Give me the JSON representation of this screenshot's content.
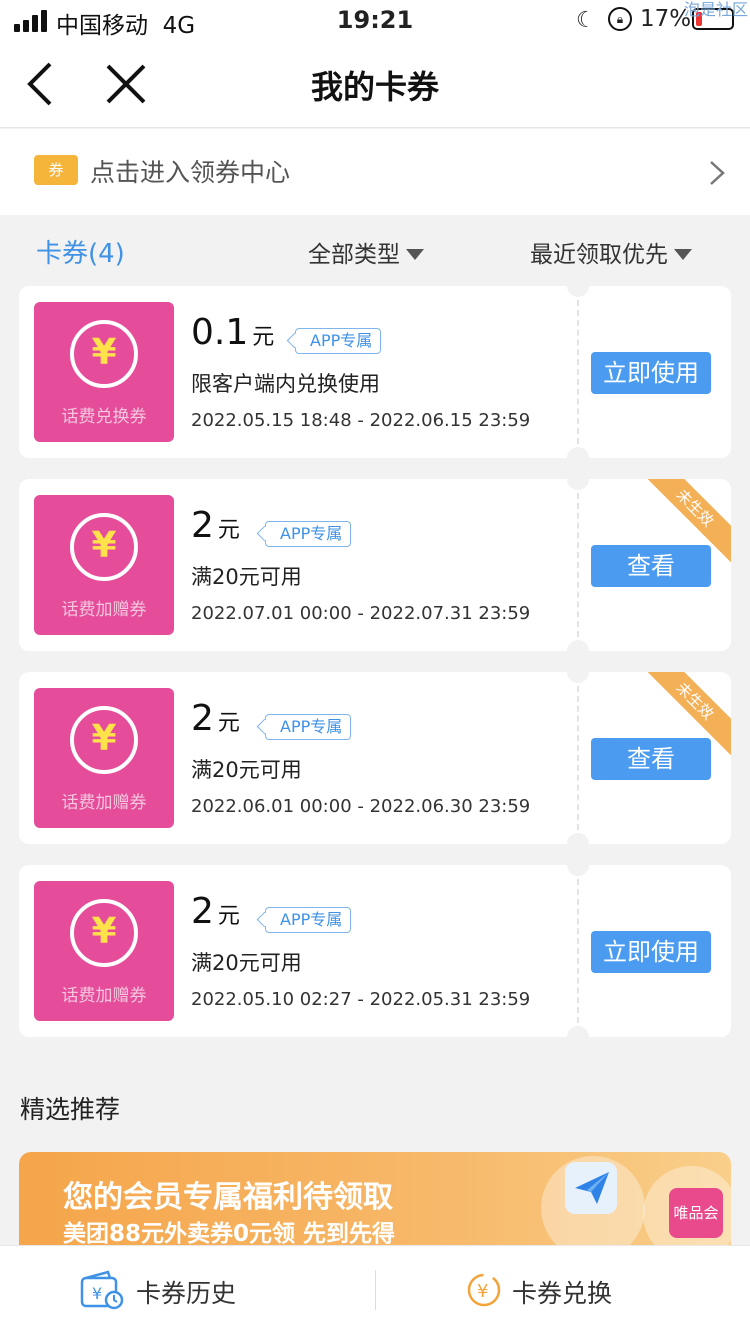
{
  "status_bar": {
    "carrier": "中国移动",
    "network": "4G",
    "time": "19:21",
    "battery": "17%",
    "watermark": "泡是社区"
  },
  "nav": {
    "title": "我的卡券",
    "back_icon": "chevron-left-icon",
    "close_icon": "close-icon"
  },
  "coupon_center": {
    "tag": "券",
    "text": "点击进入领券中心"
  },
  "filter": {
    "count_label": "卡券(4)",
    "type_label": "全部类型",
    "sort_label": "最近领取优先"
  },
  "coupons": [
    {
      "thumb_label": "话费兑换券",
      "amount": "0.1",
      "unit": "元",
      "app_tag": "APP专属",
      "desc": "限客户端内兑换使用",
      "date": "2022.05.15 18:48 - 2022.06.15 23:59",
      "button": "立即使用",
      "ribbon": ""
    },
    {
      "thumb_label": "话费加赠券",
      "amount": "2",
      "unit": "元",
      "app_tag": "APP专属",
      "desc": "满20元可用",
      "date": "2022.07.01 00:00 - 2022.07.31 23:59",
      "button": "查看",
      "ribbon": "未生效"
    },
    {
      "thumb_label": "话费加赠券",
      "amount": "2",
      "unit": "元",
      "app_tag": "APP专属",
      "desc": "满20元可用",
      "date": "2022.06.01 00:00 - 2022.06.30 23:59",
      "button": "查看",
      "ribbon": "未生效"
    },
    {
      "thumb_label": "话费加赠券",
      "amount": "2",
      "unit": "元",
      "app_tag": "APP专属",
      "desc": "满20元可用",
      "date": "2022.05.10 02:27 - 2022.05.31 23:59",
      "button": "立即使用",
      "ribbon": ""
    }
  ],
  "recommend": {
    "title": "精选推荐",
    "banner_line1": "您的会员专属福利待领取",
    "banner_line2": "美团88元外卖券0元领 先到先得",
    "banner_badge": "唯品会"
  },
  "bottom_bar": {
    "history_label": "卡券历史",
    "exchange_label": "卡券兑换"
  },
  "colors": {
    "accent_blue": "#4b9cf0",
    "coupon_pink": "#e54d9b",
    "ribbon_orange": "#f3a33a",
    "yen_yellow": "#ffe24a"
  }
}
